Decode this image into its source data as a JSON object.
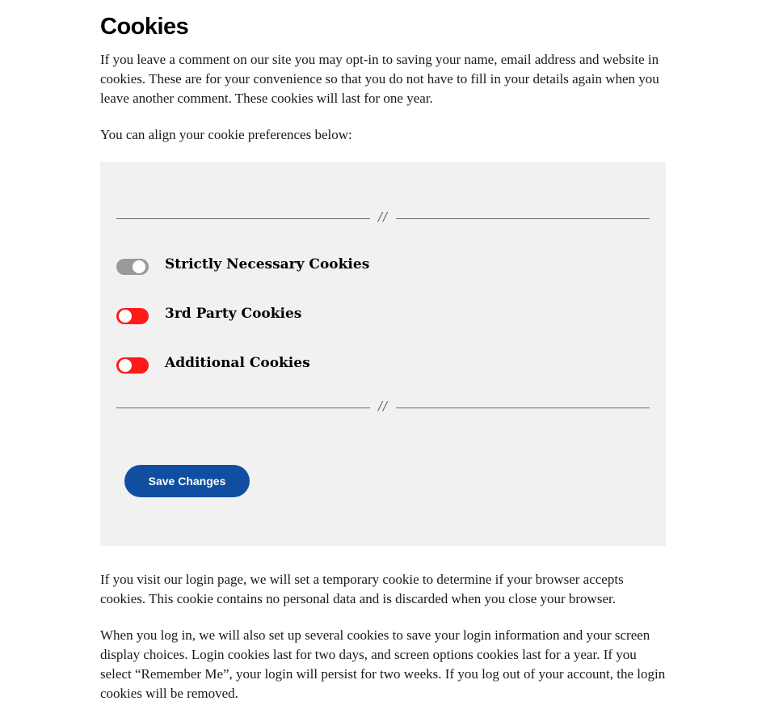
{
  "section": {
    "heading": "Cookies",
    "intro": "If you leave a comment on our site you may opt-in to saving your name, email address and website in cookies. These are for your convenience so that you do not have to fill in your details again when you leave another comment. These cookies will last for one year.",
    "align_prompt": "You can align your cookie preferences below:"
  },
  "preferences": {
    "divider_glyph": "//",
    "toggles": [
      {
        "label": "Strictly Necessary Cookies",
        "state": "on",
        "disabled": true
      },
      {
        "label": "3rd Party Cookies",
        "state": "off",
        "disabled": false
      },
      {
        "label": "Additional Cookies",
        "state": "off",
        "disabled": false
      }
    ],
    "save_label": "Save Changes"
  },
  "after": {
    "login_para": "If you visit our login page, we will set a temporary cookie to determine if your browser accepts cookies. This cookie contains no personal data and is discarded when you close your browser.",
    "login_cookies_para": "When you log in, we will also set up several cookies to save your login information and your screen display choices. Login cookies last for two days, and screen options cookies last for a year. If you select “Remember Me”, your login will persist for two weeks. If you log out of your account, the login cookies will be removed."
  },
  "colors": {
    "box_bg": "#f1f1f1",
    "toggle_on": "#9a9a9a",
    "toggle_off": "#ff1a1a",
    "button_bg": "#0f4ea1",
    "button_text": "#ffffff"
  }
}
